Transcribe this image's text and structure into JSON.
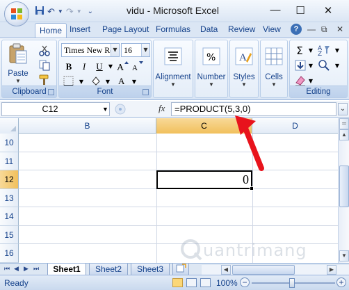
{
  "window": {
    "title": "vidu - Microsoft Excel",
    "minimize": "—",
    "restore": "☐",
    "close": "✕"
  },
  "ribbon_tabs": [
    "Home",
    "Insert",
    "Page Layout",
    "Formulas",
    "Data",
    "Review",
    "View"
  ],
  "ribbon": {
    "clipboard": {
      "label": "Clipboard",
      "paste": "Paste"
    },
    "font": {
      "label": "Font",
      "name": "Times New Roman",
      "size": "16",
      "bold": "B",
      "italic": "I",
      "underline": "U"
    },
    "alignment": "Alignment",
    "number": "Number",
    "styles": "Styles",
    "cells": "Cells",
    "editing": "Editing"
  },
  "formula_bar": {
    "name_box": "C12",
    "fx": "fx",
    "formula": "=PRODUCT(5,3,0)"
  },
  "grid": {
    "columns": [
      "B",
      "C",
      "D"
    ],
    "rows": [
      "10",
      "11",
      "12",
      "13",
      "14",
      "15",
      "16"
    ],
    "selected_column": "C",
    "selected_row": "12",
    "active_cell_value": "0"
  },
  "sheets": [
    "Sheet1",
    "Sheet2",
    "Sheet3"
  ],
  "active_sheet": "Sheet1",
  "status": {
    "text": "Ready",
    "zoom": "100%"
  },
  "colors": {
    "accent": "#15428b",
    "selection_header": "#f1c05c",
    "annotation": "#e8131c"
  },
  "watermark": "uantrimang"
}
